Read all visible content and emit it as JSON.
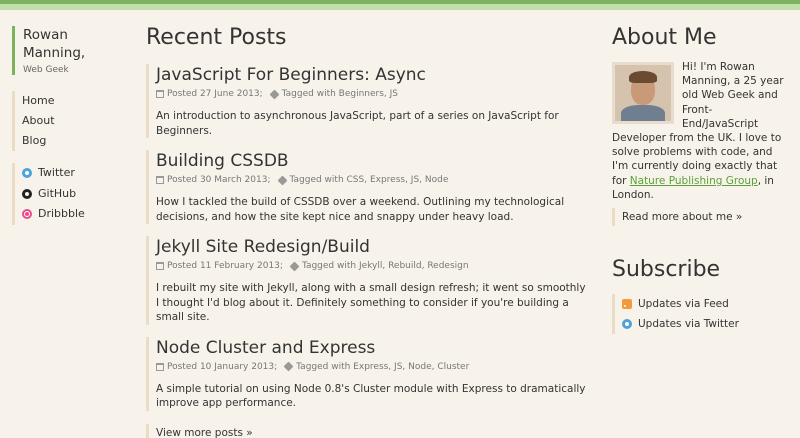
{
  "brand": {
    "name": "Rowan Manning,",
    "tagline": "Web Geek"
  },
  "nav": [
    {
      "label": "Home"
    },
    {
      "label": "About"
    },
    {
      "label": "Blog"
    }
  ],
  "social": [
    {
      "label": "Twitter",
      "icon": "twitter-icon"
    },
    {
      "label": "GitHub",
      "icon": "github-icon"
    },
    {
      "label": "Dribbble",
      "icon": "dribbble-icon"
    }
  ],
  "main": {
    "title": "Recent Posts",
    "posts": [
      {
        "title": "JavaScript For Beginners: Async",
        "posted": "Posted 27 June 2013;",
        "tagged": "Tagged with Beginners, JS",
        "excerpt": "An introduction to asynchronous JavaScript, part of a series on JavaScript for Beginners."
      },
      {
        "title": "Building CSSDB",
        "posted": "Posted 30 March 2013;",
        "tagged": "Tagged with CSS, Express, JS, Node",
        "excerpt": "How I tackled the build of CSSDB over a weekend. Outlining my technological decisions, and how the site kept nice and snappy under heavy load."
      },
      {
        "title": "Jekyll Site Redesign/Build",
        "posted": "Posted 11 February 2013;",
        "tagged": "Tagged with Jekyll, Rebuild, Redesign",
        "excerpt": "I rebuilt my site with Jekyll, along with a small design refresh; it went so smoothly I thought I'd blog about it. Definitely something to consider if you're building a small site."
      },
      {
        "title": "Node Cluster and Express",
        "posted": "Posted 10 January 2013;",
        "tagged": "Tagged with Express, JS, Node, Cluster",
        "excerpt": "A simple tutorial on using Node 0.8's Cluster module with Express to dramatically improve app performance."
      }
    ],
    "more_label": "View more posts »"
  },
  "about": {
    "title": "About Me",
    "text_before": "Hi! I'm Rowan Manning, a 25 year old Web Geek and Front-End/JavaScript Developer from the UK. I love to solve problems with code, and I'm currently doing exactly that for ",
    "link_text": "Nature Publishing Group",
    "text_after": ", in London.",
    "read_more": "Read more about me »"
  },
  "subscribe": {
    "title": "Subscribe",
    "items": [
      {
        "label": "Updates via Feed",
        "icon": "rss-icon"
      },
      {
        "label": "Updates via Twitter",
        "icon": "twitter-icon"
      }
    ]
  },
  "colors": {
    "accent": "#7db35f",
    "link": "#5aa13b",
    "background": "#f7f3ea",
    "rule": "#eadcc7"
  }
}
